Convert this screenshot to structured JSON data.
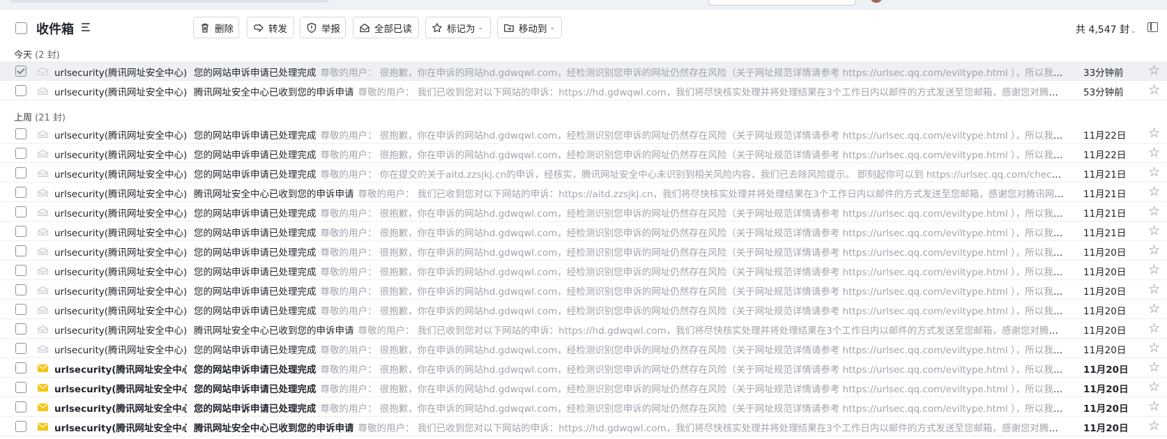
{
  "toolbar": {
    "title": "收件箱",
    "buttons": {
      "delete": "删除",
      "forward": "转发",
      "report": "举报",
      "mark_all_read": "全部已读",
      "mark_as": "标记为",
      "move_to": "移动到"
    },
    "total_count": "共 4,547 封"
  },
  "groups": {
    "today": {
      "label": "今天",
      "count": "(2 封)"
    },
    "last_week": {
      "label": "上周",
      "count": "(21 封)"
    }
  },
  "today_rows": [
    {
      "sender": "urlsecurity(腾讯网址安全中心)",
      "subject": "您的网站申诉申请已处理完成",
      "preview": "尊敬的用户： 很抱歉，你在申诉的网站hd.gdwqwl.com，经检测识别您申诉的网址仍然存在风险（关于网址规范详情请参考 https://urlsec.qq.com/eviltype.html ），所以我们将对您申...",
      "time": "33分钟前",
      "unread": false,
      "selected": true
    },
    {
      "sender": "urlsecurity(腾讯网址安全中心)",
      "subject": "腾讯网址安全中心已收到您的申诉申请",
      "preview": "尊敬的用户： 我们已收到您对以下网站的申诉：https://hd.gdwqwl.com，我们将尽快核实处理并将处理结果在3个工作日内以邮件的方式发送至您邮箱，感谢您对腾讯网址安全...",
      "time": "53分钟前",
      "unread": false,
      "selected": false
    }
  ],
  "week_rows": [
    {
      "sender": "urlsecurity(腾讯网址安全中心)",
      "subject": "您的网站申诉申请已处理完成",
      "preview": "尊敬的用户： 很抱歉，你在申诉的网站hd.gdwqwl.com，经检测识别您申诉的网址仍然存在风险（关于网址规范详情请参考 https://urlsec.qq.com/eviltype.html ），所以我们将对您申...",
      "time": "11月22日",
      "unread": false
    },
    {
      "sender": "urlsecurity(腾讯网址安全中心)",
      "subject": "您的网站申诉申请已处理完成",
      "preview": "尊敬的用户： 很抱歉，你在申诉的网站hd.gdwqwl.com，经检测识别您申诉的网址仍然存在风险（关于网址规范详情请参考 https://urlsec.qq.com/eviltype.html ），所以我们将对您申...",
      "time": "11月22日",
      "unread": false
    },
    {
      "sender": "urlsecurity(腾讯网址安全中心)",
      "subject": "您的网站申诉申请已处理完成",
      "preview": "尊敬的用户： 你在提交的关于aitd.zzsjkj.cn的申诉，经核实，腾讯网址安全中心未识别到相关风险内容，我们已去除风险提示。 即刻起你可以到 https://urlsec.qq.com/check.html 进行...",
      "time": "11月21日",
      "unread": false
    },
    {
      "sender": "urlsecurity(腾讯网址安全中心)",
      "subject": "腾讯网址安全中心已收到您的申诉申请",
      "preview": "尊敬的用户： 我们已收到您对以下网站的申诉：https://aitd.zzsjkj.cn，我们将尽快核实处理并将处理结果在3个工作日内以邮件的方式发送至您邮箱，感谢您对腾讯网址安全中...",
      "time": "11月21日",
      "unread": false
    },
    {
      "sender": "urlsecurity(腾讯网址安全中心)",
      "subject": "您的网站申诉申请已处理完成",
      "preview": "尊敬的用户： 很抱歉，你在申诉的网站hd.gdwqwl.com，经检测识别您申诉的网址仍然存在风险（关于网址规范详情请参考 https://urlsec.qq.com/eviltype.html ），所以我们将对您申...",
      "time": "11月21日",
      "unread": false
    },
    {
      "sender": "urlsecurity(腾讯网址安全中心)",
      "subject": "您的网站申诉申请已处理完成",
      "preview": "尊敬的用户： 很抱歉，你在申诉的网站hd.gdwqwl.com，经检测识别您申诉的网址仍然存在风险（关于网址规范详情请参考 https://urlsec.qq.com/eviltype.html ），所以我们将对您申...",
      "time": "11月21日",
      "unread": false
    },
    {
      "sender": "urlsecurity(腾讯网址安全中心)",
      "subject": "您的网站申诉申请已处理完成",
      "preview": "尊敬的用户： 很抱歉，你在申诉的网站hd.gdwqwl.com，经检测识别您申诉的网址仍然存在风险（关于网址规范详情请参考 https://urlsec.qq.com/eviltype.html ），所以我们将对您申...",
      "time": "11月20日",
      "unread": false
    },
    {
      "sender": "urlsecurity(腾讯网址安全中心)",
      "subject": "您的网站申诉申请已处理完成",
      "preview": "尊敬的用户： 很抱歉，你在申诉的网站hd.gdwqwl.com，经检测识别您申诉的网址仍然存在风险（关于网址规范详情请参考 https://urlsec.qq.com/eviltype.html ），所以我们将对您申...",
      "time": "11月20日",
      "unread": false
    },
    {
      "sender": "urlsecurity(腾讯网址安全中心)",
      "subject": "您的网站申诉申请已处理完成",
      "preview": "尊敬的用户： 很抱歉，你在申诉的网站hd.gdwqwl.com，经检测识别您申诉的网址仍然存在风险（关于网址规范详情请参考 https://urlsec.qq.com/eviltype.html ），所以我们将对您申...",
      "time": "11月20日",
      "unread": false
    },
    {
      "sender": "urlsecurity(腾讯网址安全中心)",
      "subject": "您的网站申诉申请已处理完成",
      "preview": "尊敬的用户： 很抱歉，你在申诉的网站hd.gdwqwl.com，经检测识别您申诉的网址仍然存在风险（关于网址规范详情请参考 https://urlsec.qq.com/eviltype.html ），所以我们将对您申...",
      "time": "11月20日",
      "unread": false
    },
    {
      "sender": "urlsecurity(腾讯网址安全中心)",
      "subject": "腾讯网址安全中心已收到您的申诉申请",
      "preview": "尊敬的用户： 我们已收到您对以下网站的申诉：https://hd.gdwqwl.com，我们将尽快核实处理并将处理结果在3个工作日内以邮件的方式发送至您邮箱，感谢您对腾讯网址安全...",
      "time": "11月20日",
      "unread": false
    },
    {
      "sender": "urlsecurity(腾讯网址安全中心)",
      "subject": "您的网站申诉申请已处理完成",
      "preview": "尊敬的用户： 很抱歉，你在申诉的网站hd.gdwqwl.com，经检测识别您申诉的网址仍然存在风险（关于网址规范详情请参考 https://urlsec.qq.com/eviltype.html ），所以我们将对您申...",
      "time": "11月20日",
      "unread": false
    },
    {
      "sender": "urlsecurity(腾讯网址安全中心)",
      "subject": "您的网站申诉申请已处理完成",
      "preview": "尊敬的用户： 很抱歉，你在申诉的网站hd.gdwqwl.com，经检测识别您申诉的网址仍然存在风险（关于网址规范详情请参考 https://urlsec.qq.com/eviltype.html ），所以我们将对您申...",
      "time": "11月20日",
      "unread": true
    },
    {
      "sender": "urlsecurity(腾讯网址安全中心)",
      "subject": "您的网站申诉申请已处理完成",
      "preview": "尊敬的用户： 很抱歉，你在申诉的网站hd.gdwqwl.com，经检测识别您申诉的网址仍然存在风险（关于网址规范详情请参考 https://urlsec.qq.com/eviltype.html ），所以我们将对您申...",
      "time": "11月20日",
      "unread": true
    },
    {
      "sender": "urlsecurity(腾讯网址安全中心)",
      "subject": "您的网站申诉申请已处理完成",
      "preview": "尊敬的用户： 很抱歉，你在申诉的网站hd.gdwqwl.com，经检测识别您申诉的网址仍然存在风险（关于网址规范详情请参考 https://urlsec.qq.com/eviltype.html ），所以我们将对您申...",
      "time": "11月20日",
      "unread": true
    },
    {
      "sender": "urlsecurity(腾讯网址安全中心)",
      "subject": "腾讯网址安全中心已收到您的申诉申请",
      "preview": "尊敬的用户： 我们已收到您对以下网站的申诉：https://hd.gdwqwl.com，我们将尽快核实处理并将处理结果在3个工作日内以邮件的方式发送至您邮箱，感谢您对腾讯网址安全...",
      "time": "11月20日",
      "unread": true
    }
  ],
  "colors": {
    "unread_envelope": "#f5c518",
    "read_envelope": "#c4c8ce",
    "preview_text": "#a0a4ab",
    "selected_row": "#eef0f3"
  }
}
